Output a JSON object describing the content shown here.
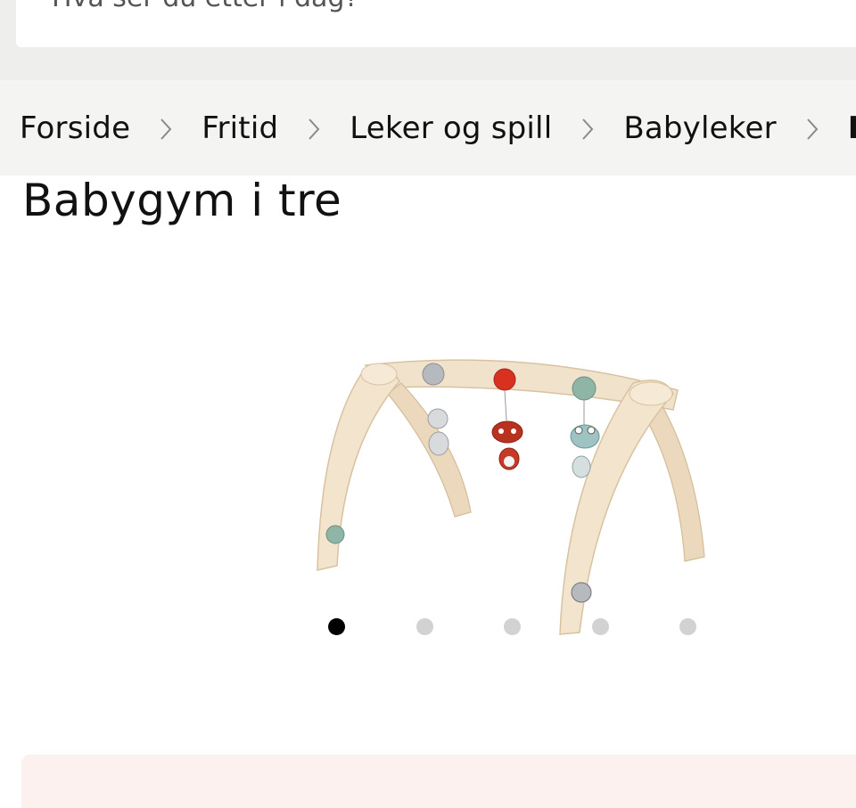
{
  "search": {
    "placeholder": "Hva ser du etter i dag?"
  },
  "breadcrumb": {
    "items": [
      {
        "label": "Forside"
      },
      {
        "label": "Fritid"
      },
      {
        "label": "Leker og spill"
      },
      {
        "label": "Babyleker"
      }
    ],
    "current": "B"
  },
  "product": {
    "title": "Babygym i tre",
    "image_icon": "wooden-baby-gym-image"
  },
  "carousel": {
    "total_slides": 5,
    "active_slide": 1
  },
  "colors": {
    "top_bar": "#eeeeec",
    "breadcrumb_bg": "#f4f4f3",
    "dot_active": "#000000",
    "dot_inactive": "#d2d2d2",
    "promo_bg": "#fdf1ef"
  }
}
